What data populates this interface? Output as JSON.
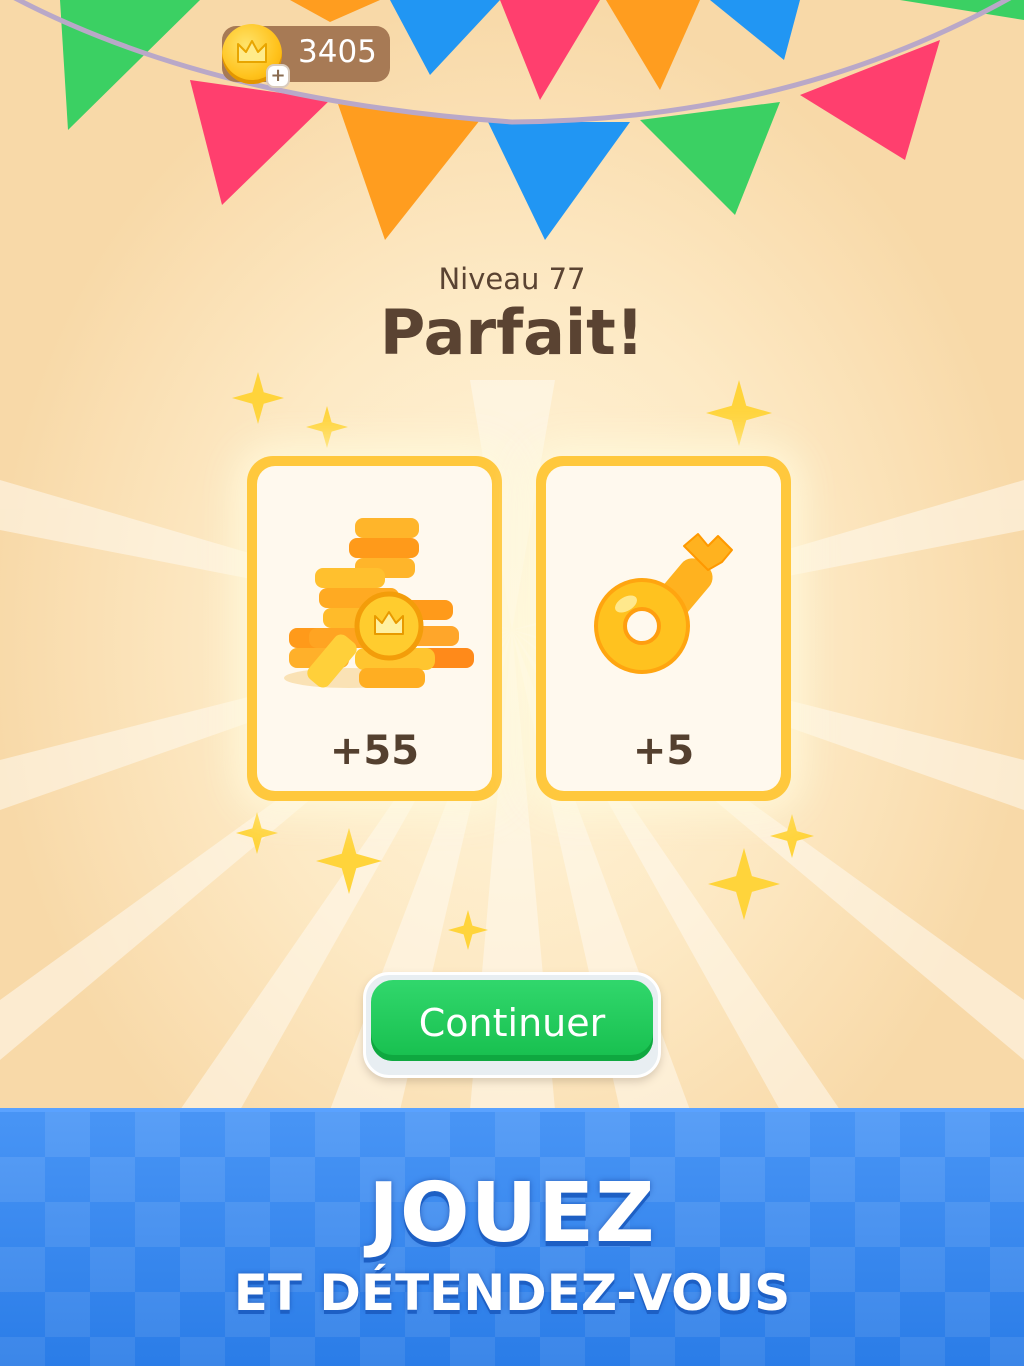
{
  "header": {
    "coin_balance": "3405",
    "coin_icon": "crown-coin-icon",
    "add_icon": "plus-icon",
    "add_symbol": "+"
  },
  "result": {
    "level_label": "Niveau 77",
    "title": "Parfait!"
  },
  "rewards": [
    {
      "icon": "coin-pile-icon",
      "value": "+55"
    },
    {
      "icon": "key-icon",
      "value": "+5"
    }
  ],
  "actions": {
    "continue_label": "Continuer"
  },
  "promo": {
    "headline": "JOUEZ",
    "subheadline": "ET DÉTENDEZ-VOUS"
  },
  "colors": {
    "accent_green": "#1fc95a",
    "card_border": "#ffc83d",
    "banner_blue": "#2f86f4",
    "text_brown": "#5a4332"
  }
}
